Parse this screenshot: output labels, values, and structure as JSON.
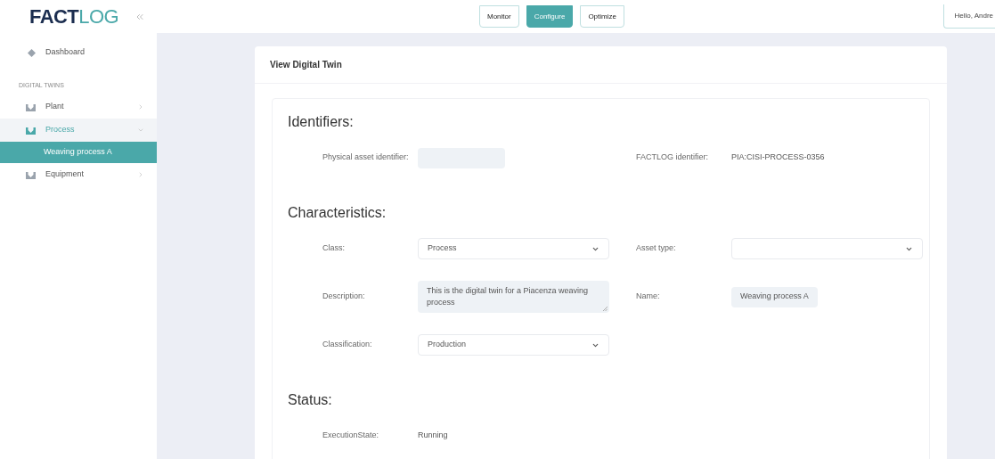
{
  "logo": {
    "strong": "FACT",
    "light": "LOG"
  },
  "sidebar": {
    "items": [
      {
        "kind": "link",
        "label": "Dashboard",
        "selected": false
      },
      {
        "kind": "section",
        "label": "DIGITAL TWINS"
      },
      {
        "kind": "group",
        "label": "Plant",
        "expanded": false,
        "selected": false
      },
      {
        "kind": "group",
        "label": "Process",
        "expanded": true,
        "selected": true,
        "children": [
          {
            "label": "Weaving process A",
            "selected": true
          }
        ]
      },
      {
        "kind": "group",
        "label": "Equipment",
        "expanded": false,
        "selected": false
      }
    ]
  },
  "top_nav": [
    {
      "label": "Monitor",
      "selected": false
    },
    {
      "label": "Configure",
      "selected": true
    },
    {
      "label": "Optimize",
      "selected": false
    }
  ],
  "user_button": "Hello, Andre",
  "card": {
    "title": "View Digital Twin",
    "sections": [
      {
        "title": "Identifiers:",
        "rows": [
          [
            {
              "label": "Physical asset identifier:",
              "kind": "input"
            },
            {
              "label": "FACTLOG identifier:",
              "kind": "text",
              "value": "PIA:CISI-PROCESS-0356"
            }
          ]
        ]
      },
      {
        "title": "Characteristics:",
        "rows": [
          [
            {
              "label": "Class:",
              "kind": "select",
              "value": "Process"
            },
            {
              "label": "Asset type:",
              "kind": "select"
            }
          ],
          [
            {
              "label": "Description:",
              "kind": "textarea",
              "value": "This is the digital twin for a Piacenza weaving process"
            },
            {
              "label": "Name:",
              "kind": "input",
              "value": "Weaving process A"
            }
          ],
          [
            {
              "label": "Classification:",
              "kind": "select",
              "value": "Production"
            }
          ]
        ]
      },
      {
        "title": "Status:",
        "rows": [
          [
            {
              "label": "ExecutionState:",
              "kind": "text",
              "value": "Running"
            }
          ]
        ]
      }
    ]
  }
}
